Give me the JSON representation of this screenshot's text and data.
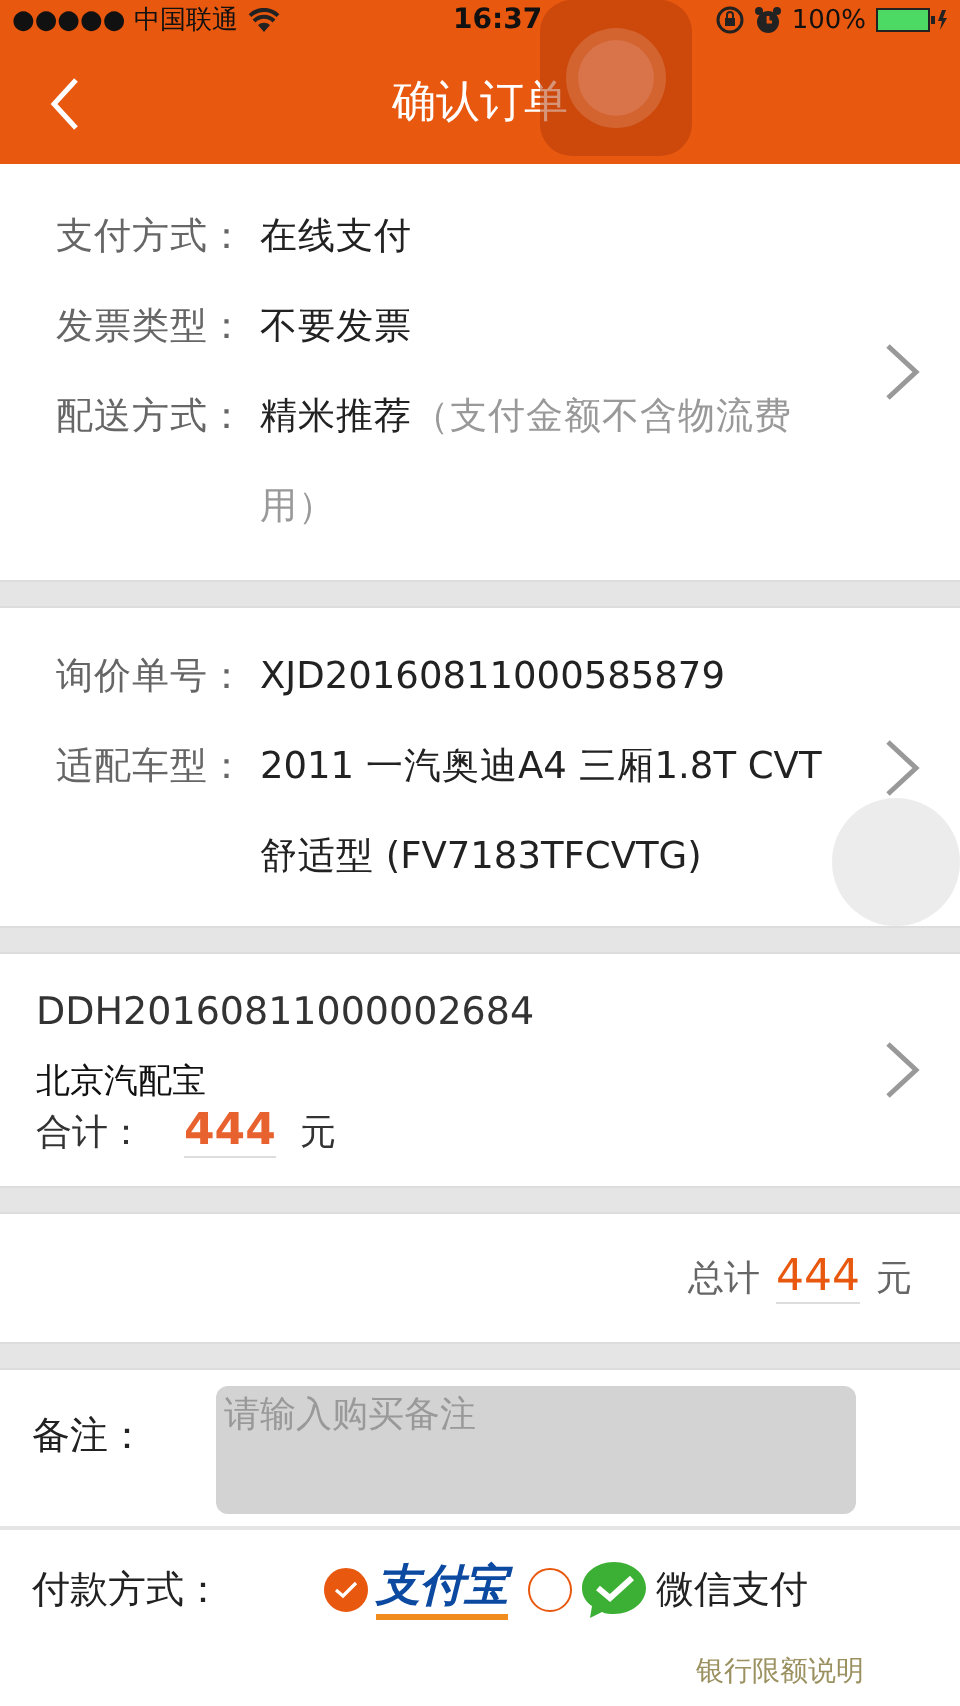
{
  "status_bar": {
    "carrier": "●●●●● 中国联通",
    "time": "16:37",
    "battery": "100%"
  },
  "nav": {
    "title": "确认订单"
  },
  "order_info": [
    {
      "label": "支付方式：",
      "value": "在线支付"
    },
    {
      "label": "发票类型：",
      "value": "不要发票"
    },
    {
      "label": "配送方式：",
      "value": "精米推荐",
      "note": "（支付金额不含物流费用）"
    }
  ],
  "inquiry": [
    {
      "label": "询价单号：",
      "value": "XJD20160811000585879"
    },
    {
      "label": "适配车型：",
      "value": "2011 一汽奥迪A4 三厢1.8T CVT 舒适型 (FV7183TFCVTG)"
    }
  ],
  "order": {
    "number": "DDH20160811000002684",
    "store": "北京汽配宝",
    "subtotal_label": "合计：",
    "subtotal": "444",
    "currency": "元"
  },
  "total": {
    "label": "总计",
    "amount": "444",
    "currency": "元"
  },
  "remark": {
    "label": "备注：",
    "placeholder": "请输入购买备注"
  },
  "payment": {
    "label": "付款方式：",
    "options": [
      {
        "kind": "alipay",
        "label": "支付宝",
        "selected": true
      },
      {
        "kind": "wechat",
        "label": "微信支付",
        "selected": false
      }
    ],
    "note": "银行限额说明"
  }
}
